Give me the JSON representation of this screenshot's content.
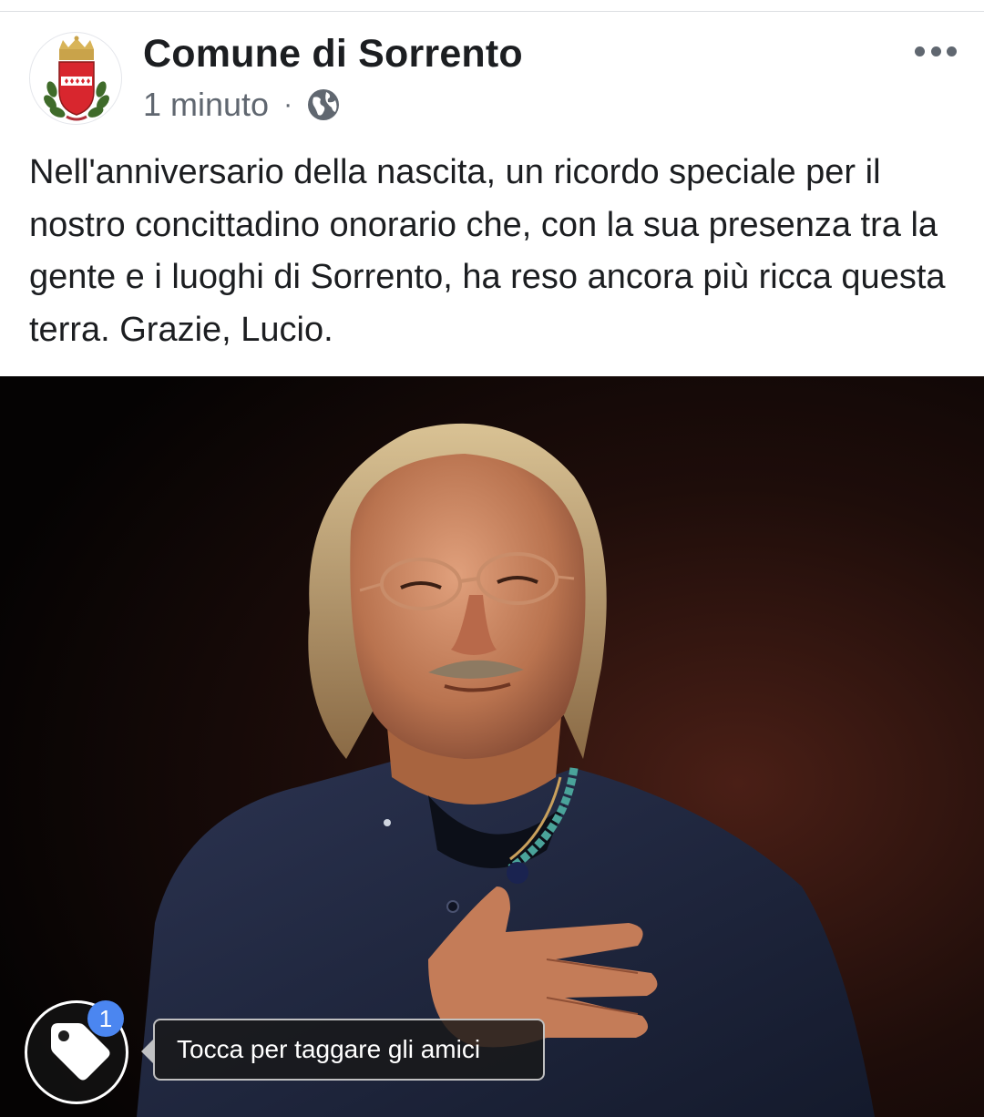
{
  "post": {
    "page_name": "Comune di Sorrento",
    "time": "1 minuto",
    "separator": "·",
    "audience_icon": "globe-icon",
    "more_icon": "more-options-icon",
    "text": "Nell'anniversario della nascita, un ricordo speciale per il nostro concittadino onorario che, con la sua presenza tra la gente e i luoghi di Sorrento, ha reso ancora più ricca questa terra. Grazie, Lucio."
  },
  "photo": {
    "tag_button_icon": "tag-icon",
    "tag_count": "1",
    "tag_hint": "Tocca per taggare gli amici"
  },
  "colors": {
    "text_primary": "#1c1e21",
    "text_secondary": "#606770",
    "badge": "#4b86f0"
  }
}
